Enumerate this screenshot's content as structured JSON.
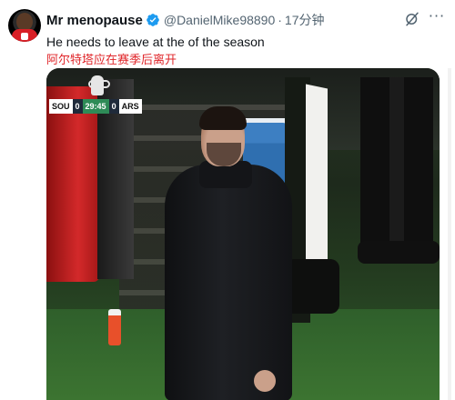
{
  "tweet": {
    "author_name": "Mr menopause",
    "handle": "@DanielMike98890",
    "separator": "·",
    "time": "17分钟",
    "text_en": "He needs to leave at the of the season",
    "text_cn": "阿尔特塔应在赛季后离开",
    "more_label": "···"
  },
  "video": {
    "scoreboard": {
      "home_team": "SOU",
      "home_score": "0",
      "clock": "29:45",
      "away_score": "0",
      "away_team": "ARS"
    }
  },
  "icons": [
    "avatar",
    "verified-badge-icon",
    "grok-icon",
    "more-options-icon",
    "fa-cup-logo-icon"
  ],
  "colors": {
    "verified": "#1d9bf0",
    "handle": "#536471",
    "translation_text": "#e0262a",
    "scoreboard_clock": "#2e8b57"
  }
}
